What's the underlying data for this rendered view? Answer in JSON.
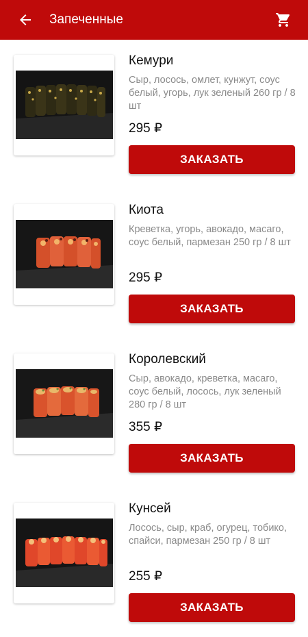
{
  "header": {
    "back_icon": "arrow-left-icon",
    "title": "Запеченные",
    "cart_icon": "shopping-cart-icon",
    "bg_color": "#bf0a0a"
  },
  "products": [
    {
      "name": "Кемури",
      "description": "Сыр, лосось, омлет, кунжут, соус белый, угорь, лук зеленый 260 гр / 8 шт",
      "price": "295 ₽",
      "order_label": "ЗАКАЗАТЬ"
    },
    {
      "name": "Киота",
      "description": "Креветка, угорь, авокадо, масаго, соус белый, пармезан 250 гр / 8 шт",
      "price": "295 ₽",
      "order_label": "ЗАКАЗАТЬ"
    },
    {
      "name": "Королевский",
      "description": "Сыр, авокадо, креветка, масаго, соус белый, лосось, лук зеленый  280 гр / 8 шт",
      "price": "355 ₽",
      "order_label": "ЗАКАЗАТЬ"
    },
    {
      "name": "Кунсей",
      "description": "Лосось, сыр, краб, огурец, тобико, спайси, пармезан  250 гр / 8 шт",
      "price": "255 ₽",
      "order_label": "ЗАКАЗАТЬ"
    }
  ]
}
